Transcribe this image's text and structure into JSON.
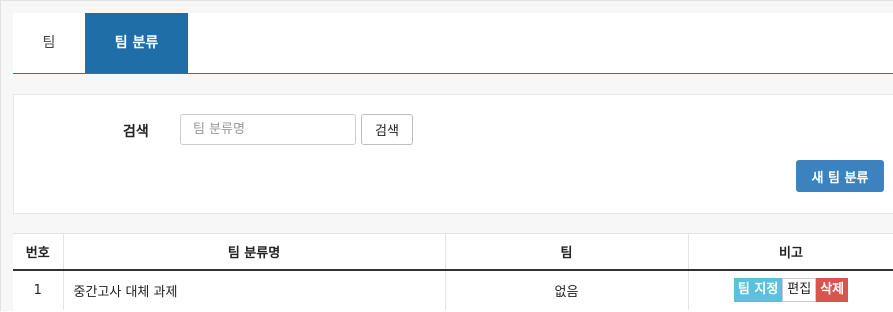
{
  "tabs": [
    {
      "label": "팀"
    },
    {
      "label": "팀 분류"
    }
  ],
  "search": {
    "label": "검색",
    "placeholder": "팀 분류명",
    "value": "",
    "button_label": "검색"
  },
  "actions": {
    "new_label": "새 팀 분류"
  },
  "table": {
    "headers": [
      "번호",
      "팀 분류명",
      "팀",
      "비고"
    ],
    "rows": [
      {
        "num": "1",
        "name": "중간고사 대체 과제",
        "team": "없음",
        "buttons": {
          "assign": "팀 지정",
          "edit": "편집",
          "delete": "삭제"
        }
      }
    ]
  },
  "colors": {
    "active_tab": "#1f6ea8",
    "primary_button": "#3a83bf",
    "info_button": "#5bc0de",
    "danger_button": "#d9534f"
  }
}
